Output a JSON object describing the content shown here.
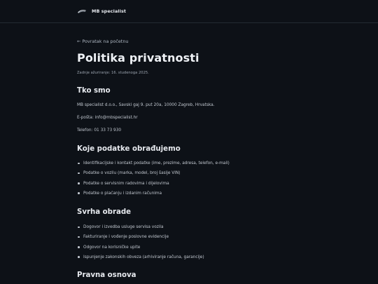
{
  "header": {
    "brand": "MB specialist"
  },
  "nav": {
    "back_label": "← Povratak na početnu"
  },
  "page": {
    "title": "Politika privatnosti",
    "updated": "Zadnje ažuriranje: 16. studenoga 2025."
  },
  "sections": {
    "who": {
      "heading": "Tko smo",
      "address": "MB specialist d.o.o., Savski gaj 9. put 20a, 10000 Zagreb, Hrvatska.",
      "email_label": "E-pošta: ",
      "email": "info@mbspecialist.hr",
      "phone": "Telefon: 01 33 73 930"
    },
    "data": {
      "heading": "Koje podatke obrađujemo",
      "items": [
        "Identifikacijske i kontakt podatke (ime, prezime, adresa, telefon, e-mail)",
        "Podatke o vozilu (marka, model, broj šasije VIN)",
        "Podatke o servisnim radovima i dijelovima",
        "Podatke o plaćanju i izdanim računima"
      ]
    },
    "purpose": {
      "heading": "Svrha obrade",
      "items": [
        "Dogovor i izvedba usluge servisa vozila",
        "Fakturiranje i vođenje poslovne evidencije",
        "Odgovor na korisničke upite",
        "Ispunjenje zakonskih obveza (arhiviranje računa, garancije)"
      ]
    },
    "legal": {
      "heading": "Pravna osnova"
    }
  },
  "colors": {
    "background": "#0d1117",
    "heading": "#eef1f5",
    "text": "#c2c8d0"
  }
}
